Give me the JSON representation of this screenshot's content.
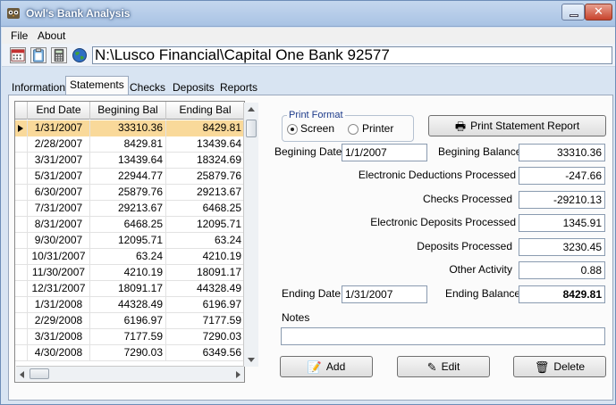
{
  "window": {
    "title": "Owl's Bank Analysis"
  },
  "menu": [
    "File",
    "About"
  ],
  "toolbar": {
    "icons": [
      "calendar-icon",
      "clipboard-icon",
      "calculator-icon",
      "globe-icon"
    ],
    "path": "N:\\Lusco Financial\\Capital One Bank 92577"
  },
  "tabs": [
    {
      "label": "Information"
    },
    {
      "label": "Statements",
      "active": true
    },
    {
      "label": "Checks"
    },
    {
      "label": "Deposits"
    },
    {
      "label": "Reports"
    }
  ],
  "grid": {
    "columns": [
      "End Date",
      "Begining Bal",
      "Ending Bal"
    ],
    "rows": [
      {
        "date": "1/31/2007",
        "begin": "33310.36",
        "end": "8429.81",
        "selected": true
      },
      {
        "date": "2/28/2007",
        "begin": "8429.81",
        "end": "13439.64"
      },
      {
        "date": "3/31/2007",
        "begin": "13439.64",
        "end": "18324.69"
      },
      {
        "date": "5/31/2007",
        "begin": "22944.77",
        "end": "25879.76"
      },
      {
        "date": "6/30/2007",
        "begin": "25879.76",
        "end": "29213.67"
      },
      {
        "date": "7/31/2007",
        "begin": "29213.67",
        "end": "6468.25"
      },
      {
        "date": "8/31/2007",
        "begin": "6468.25",
        "end": "12095.71"
      },
      {
        "date": "9/30/2007",
        "begin": "12095.71",
        "end": "63.24"
      },
      {
        "date": "10/31/2007",
        "begin": "63.24",
        "end": "4210.19"
      },
      {
        "date": "11/30/2007",
        "begin": "4210.19",
        "end": "18091.17"
      },
      {
        "date": "12/31/2007",
        "begin": "18091.17",
        "end": "44328.49"
      },
      {
        "date": "1/31/2008",
        "begin": "44328.49",
        "end": "6196.97"
      },
      {
        "date": "2/29/2008",
        "begin": "6196.97",
        "end": "7177.59"
      },
      {
        "date": "3/31/2008",
        "begin": "7177.59",
        "end": "7290.03"
      },
      {
        "date": "4/30/2008",
        "begin": "7290.03",
        "end": "6349.56"
      }
    ]
  },
  "print_format": {
    "title": "Print Format",
    "options": [
      "Screen",
      "Printer"
    ],
    "selected": "Screen"
  },
  "buttons": {
    "print": "Print  Statement Report",
    "add": "Add",
    "edit": "Edit",
    "delete": "Delete"
  },
  "form": {
    "begin_date_label": "Begining Date",
    "begin_date": "1/1/2007",
    "begin_balance_label": "Begining Balance",
    "begin_balance": "33310.36",
    "edp_label": "Electronic Deductions Processed",
    "edp": "-247.66",
    "checks_label": "Checks Processed",
    "checks": "-29210.13",
    "edep_label": "Electronic Deposits Processed",
    "edep": "1345.91",
    "deposits_label": "Deposits Processed",
    "deposits": "3230.45",
    "other_label": "Other Activity",
    "other": "0.88",
    "end_date_label": "Ending Date",
    "end_date": "1/31/2007",
    "end_balance_label": "Ending Balance",
    "end_balance": "8429.81",
    "notes_label": "Notes",
    "notes": ""
  }
}
